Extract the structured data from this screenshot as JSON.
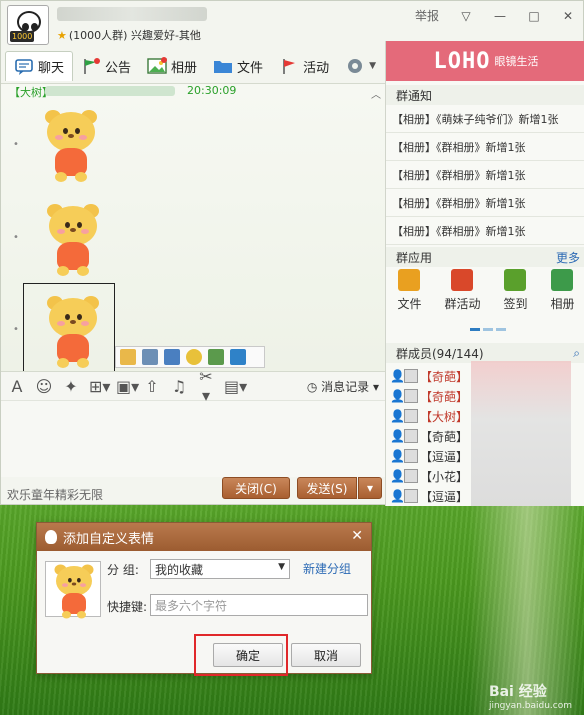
{
  "window": {
    "group_info": "(1000人群) 兴趣爱好-其他",
    "report_label": "举报",
    "avatar_badge": "1000",
    "controls": {
      "dropdown": "▽",
      "minimize": "—",
      "maximize": "□",
      "close": "✕"
    }
  },
  "tabs": [
    {
      "label": "聊天"
    },
    {
      "label": "公告"
    },
    {
      "label": "相册"
    },
    {
      "label": "文件"
    },
    {
      "label": "活动"
    }
  ],
  "chat": {
    "sender_tag": "【大树】",
    "time": "20:30:09"
  },
  "toolbar": {
    "msg_record": "消息记录"
  },
  "input": {
    "footer_text": "欢乐童年精彩无限",
    "close_label": "关闭(C)",
    "send_label": "发送(S)"
  },
  "right": {
    "banner_logo": "LOHO",
    "banner_sub": "眼镜生活",
    "notice_title": "群通知",
    "notices": [
      "【相册】《萌妹子纯爷们》新增1张",
      "【相册】《群相册》新增1张",
      "【相册】《群相册》新增1张",
      "【相册】《群相册》新增1张",
      "【相册】《群相册》新增1张"
    ],
    "apps_title": "群应用",
    "apps_more": "更多",
    "apps": [
      {
        "label": "文件",
        "color": "#e9a020"
      },
      {
        "label": "群活动",
        "color": "#d9482a"
      },
      {
        "label": "签到",
        "color": "#5aa02c"
      },
      {
        "label": "相册",
        "color": "#3d9a4a"
      }
    ],
    "members_title": "群成员(94/144)",
    "members": [
      {
        "tag": "【奇葩】",
        "red": true
      },
      {
        "tag": "【奇葩】",
        "red": true
      },
      {
        "tag": "【大树】",
        "red": true
      },
      {
        "tag": "【奇葩】",
        "red": false
      },
      {
        "tag": "【逗逼】",
        "red": false
      },
      {
        "tag": "【小花】",
        "red": false
      },
      {
        "tag": "【逗逼】",
        "red": false
      }
    ]
  },
  "dialog": {
    "title": "添加自定义表情",
    "close": "✕",
    "group_label": "分  组:",
    "group_value": "我的收藏",
    "new_group_link": "新建分组",
    "shortcut_label": "快捷键:",
    "shortcut_placeholder": "最多六个字符",
    "ok_label": "确定",
    "cancel_label": "取消"
  },
  "watermark": {
    "brand": "Bai 经验",
    "url": "jingyan.baidu.com"
  }
}
